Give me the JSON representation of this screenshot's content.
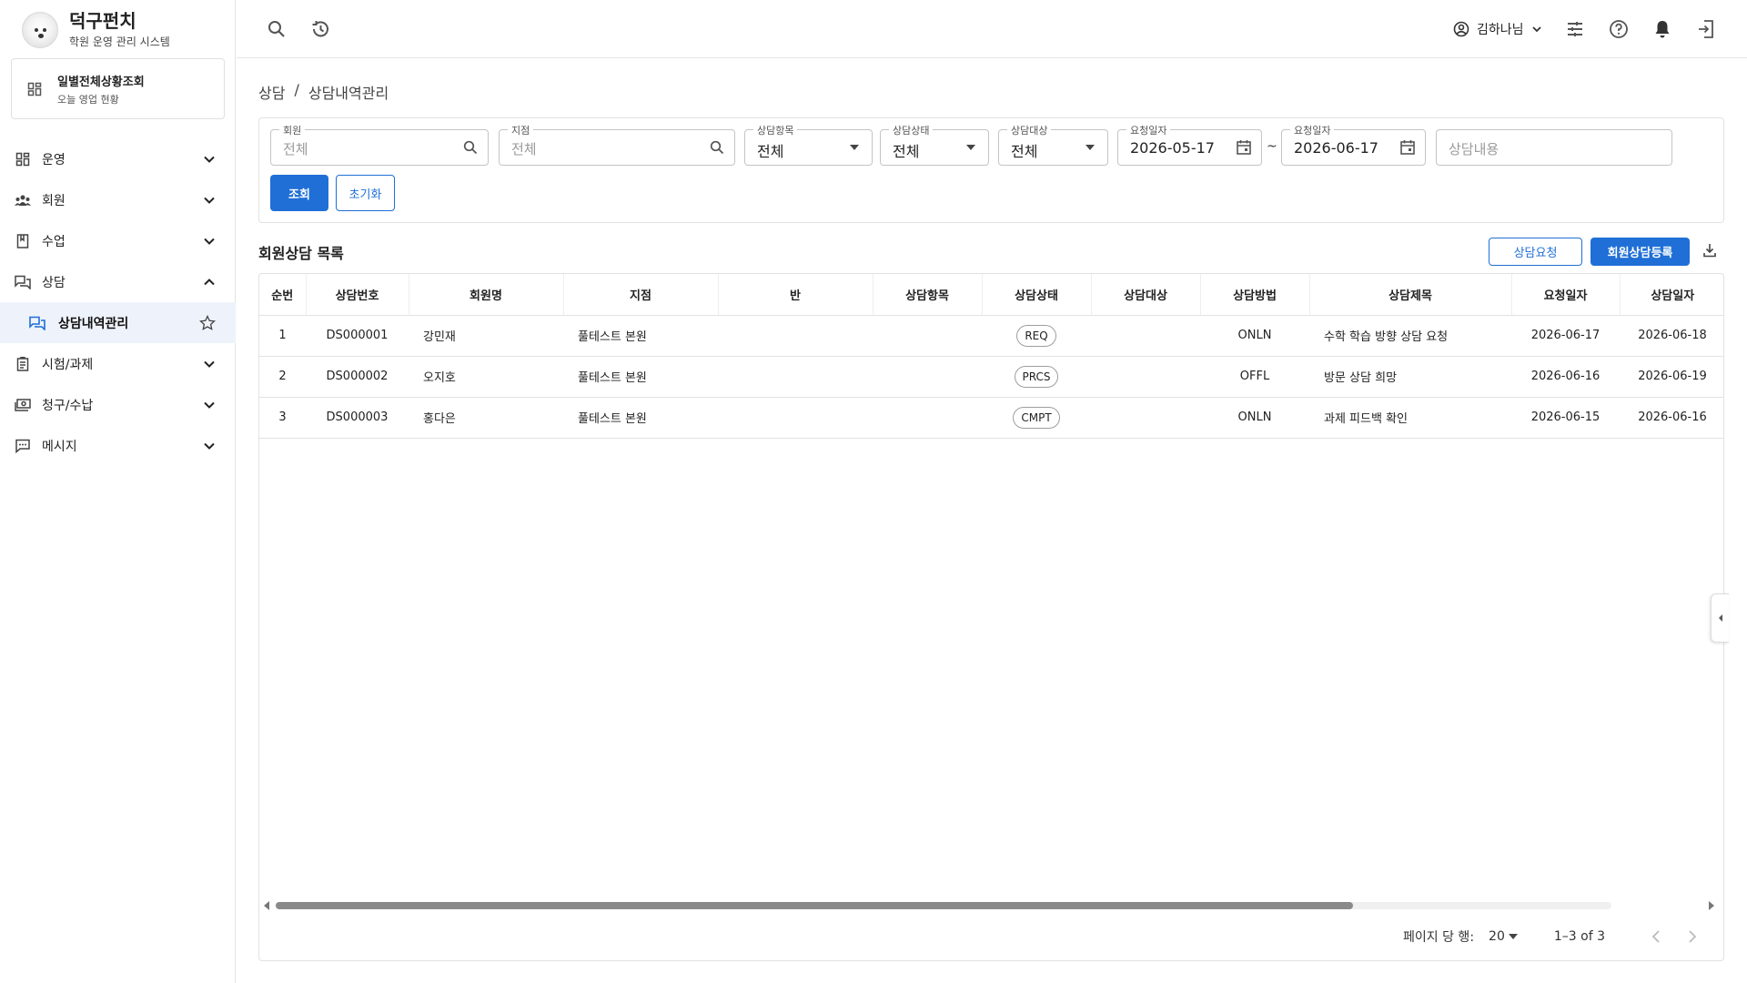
{
  "brand": {
    "title": "덕구펀치",
    "subtitle": "학원 운영 관리 시스템"
  },
  "dashboard_card": {
    "title": "일별전체상황조회",
    "subtitle": "오늘 영업 현황"
  },
  "sidebar": {
    "items": [
      {
        "label": "운영",
        "icon": "grid-icon",
        "expanded": false
      },
      {
        "label": "회원",
        "icon": "people-icon",
        "expanded": false
      },
      {
        "label": "수업",
        "icon": "book-icon",
        "expanded": false
      },
      {
        "label": "상담",
        "icon": "chat-icon",
        "expanded": true
      },
      {
        "label": "시험/과제",
        "icon": "assignment-icon",
        "expanded": false
      },
      {
        "label": "청구/수납",
        "icon": "money-icon",
        "expanded": false
      },
      {
        "label": "메시지",
        "icon": "message-icon",
        "expanded": false
      }
    ],
    "active_sub": {
      "label": "상담내역관리"
    }
  },
  "topbar": {
    "user_name": "김하나님"
  },
  "breadcrumb": {
    "parent": "상담",
    "separator": "/",
    "current": "상담내역관리"
  },
  "filters": {
    "member": {
      "label": "회원",
      "placeholder": "전체"
    },
    "branch": {
      "label": "지점",
      "placeholder": "전체"
    },
    "category": {
      "label": "상담항목",
      "value": "전체"
    },
    "status": {
      "label": "상담상태",
      "value": "전체"
    },
    "target": {
      "label": "상담대상",
      "value": "전체"
    },
    "date_from": {
      "label": "요청일자",
      "value": "2026-05-17"
    },
    "date_sep": "~",
    "date_to": {
      "label": "요청일자",
      "value": "2026-06-17"
    },
    "content": {
      "placeholder": "상담내용"
    },
    "search_button": "조회",
    "reset_button": "초기화"
  },
  "list": {
    "title": "회원상담 목록",
    "request_button": "상담요청",
    "register_button": "회원상담등록",
    "columns": [
      "순번",
      "상담번호",
      "회원명",
      "지점",
      "반",
      "상담항목",
      "상담상태",
      "상담대상",
      "상담방법",
      "상담제목",
      "요청일자",
      "상담일자"
    ],
    "rows": [
      {
        "seq": "1",
        "no": "DS000001",
        "member": "강민재",
        "branch": "풀테스트 본원",
        "class": "",
        "category": "",
        "status": "REQ",
        "target": "",
        "method": "ONLN",
        "title": "수학 학습 방향 상담 요청",
        "req_date": "2026-06-17",
        "cons_date": "2026-06-18"
      },
      {
        "seq": "2",
        "no": "DS000002",
        "member": "오지호",
        "branch": "풀테스트 본원",
        "class": "",
        "category": "",
        "status": "PRCS",
        "target": "",
        "method": "OFFL",
        "title": "방문 상담 희망",
        "req_date": "2026-06-16",
        "cons_date": "2026-06-19"
      },
      {
        "seq": "3",
        "no": "DS000003",
        "member": "홍다은",
        "branch": "풀테스트 본원",
        "class": "",
        "category": "",
        "status": "CMPT",
        "target": "",
        "method": "ONLN",
        "title": "과제 피드백 확인",
        "req_date": "2026-06-15",
        "cons_date": "2026-06-16"
      }
    ]
  },
  "pagination": {
    "rows_per_page_label": "페이지 당 행:",
    "rows_per_page": "20",
    "range": "1–3 of 3"
  },
  "colors": {
    "accent": "#1f6fd6",
    "active_nav_bg": "#eef3fb"
  }
}
